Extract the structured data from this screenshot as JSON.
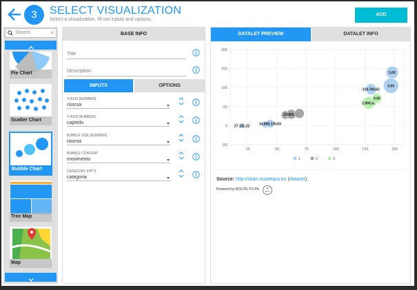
{
  "header": {
    "step": "3",
    "title": "SELECT VISUALIZATION",
    "subtitle": "Select a visualization, fill out inputs and options.",
    "add_label": "ADD"
  },
  "sidebar": {
    "search_placeholder": "Search",
    "search_clear": "×",
    "items": [
      {
        "label": "Pie Chart"
      },
      {
        "label": "Scatter Chart"
      },
      {
        "label": "Bubble Chart"
      },
      {
        "label": "Tree Map"
      },
      {
        "label": "Map"
      }
    ],
    "selected": "Bubble Chart"
  },
  "base_info": {
    "header": "BASE INFO",
    "title_placeholder": "Title",
    "description_placeholder": "Description"
  },
  "tabs": {
    "inputs": "INPUTS",
    "options": "OPTIONS"
  },
  "inputs": [
    {
      "label": "X-AXIS [NUMBER]",
      "value": "risorsa"
    },
    {
      "label": "Y-AXIS [NUMBER]",
      "value": "capitolo"
    },
    {
      "label": "BUBBLE SIZE [NUMBER]",
      "value": "risorsa"
    },
    {
      "label": "BUBBLE CONTENT",
      "value": "movimento"
    },
    {
      "label": "CATEGORY [OPT]",
      "value": "categoria"
    }
  ],
  "right_tabs": {
    "preview": "DATALET PREVIEW",
    "info": "DATALET INFO"
  },
  "chart_data": {
    "type": "scatter",
    "x_ticks": [
      "25",
      "50",
      "75",
      "100",
      "125",
      "150"
    ],
    "y_ticks": [
      "200",
      "150",
      "100",
      "50",
      "0",
      "-50"
    ],
    "xlim": [
      10,
      158
    ],
    "ylim": [
      -50,
      200
    ],
    "series": [
      {
        "name": "1",
        "color": "#a9cdef",
        "points": [
          {
            "x": 20,
            "y": 0,
            "r": 4,
            "label": "27.131,22"
          },
          {
            "x": 40,
            "y": 3,
            "r": 5,
            "label": ""
          },
          {
            "x": 44,
            "y": 5,
            "r": 6,
            "label": "14.886.139,83"
          },
          {
            "x": 130,
            "y": 96,
            "r": 8,
            "label": "224.780,62"
          },
          {
            "x": 148,
            "y": 140,
            "r": 9,
            "label": "0,00"
          },
          {
            "x": 147,
            "y": 105,
            "r": 11,
            "label": "0,00"
          }
        ]
      },
      {
        "name": "2",
        "color": "#9e9e9e",
        "points": [
          {
            "x": 57,
            "y": 28,
            "r": 6,
            "label": ""
          },
          {
            "x": 62,
            "y": 30,
            "r": 7,
            "label": "29.805,16"
          },
          {
            "x": 69,
            "y": 32,
            "r": 7,
            "label": ""
          }
        ]
      },
      {
        "name": "3",
        "color": "#b2f0a8",
        "points": [
          {
            "x": 128,
            "y": 60,
            "r": 9,
            "label": "2.899,41"
          },
          {
            "x": 135,
            "y": 72,
            "r": 7,
            "label": "0,00"
          }
        ]
      }
    ]
  },
  "source": {
    "label": "Source:",
    "url": "http://ckan.routetopa.eu",
    "open_paren": "(",
    "dataset": "dataset",
    "close_paren": ")"
  },
  "powered_by": "Powered by ROUTE-TO-PA",
  "rtp_logo": "RTP",
  "colors": {
    "accent": "#2196f3",
    "add_button": "#00bcd4"
  }
}
